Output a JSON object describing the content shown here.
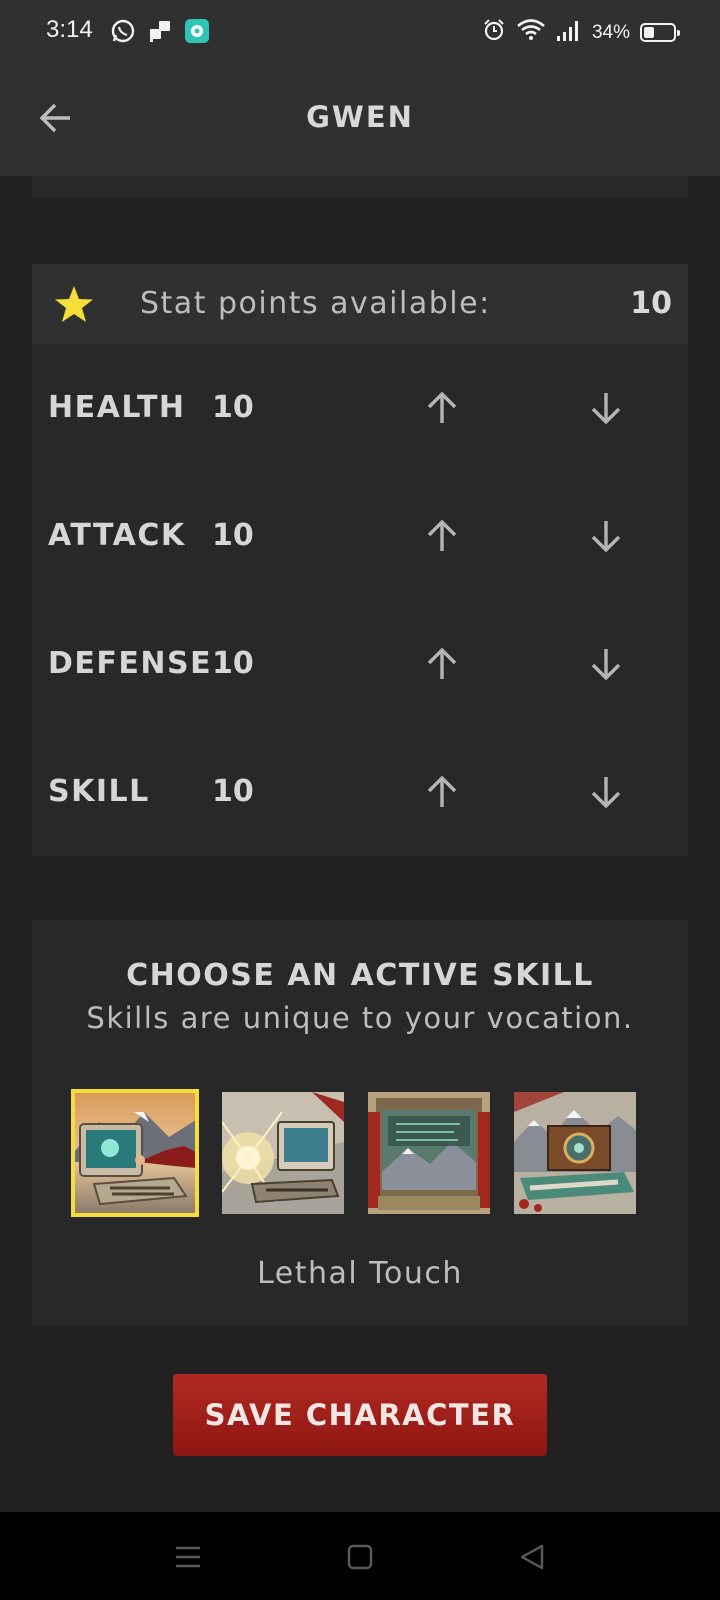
{
  "status_bar": {
    "time": "3:14",
    "battery_text": "34%",
    "battery_level": 0.34,
    "left_icons": [
      "whatsapp-icon",
      "message-icon",
      "app-icon"
    ],
    "right_icons": [
      "alarm-icon",
      "wifi-icon",
      "signal-icon",
      "battery-icon"
    ]
  },
  "app_bar": {
    "title": "GWEN",
    "back_icon": "arrow-left-icon"
  },
  "stats": {
    "points_label": "Stat points available:",
    "points_value": "10",
    "star_color": "#f5de3a",
    "rows": [
      {
        "name": "HEALTH",
        "value": "10"
      },
      {
        "name": "ATTACK",
        "value": "10"
      },
      {
        "name": "DEFENSE",
        "value": "10"
      },
      {
        "name": "SKILL",
        "value": "10"
      }
    ]
  },
  "skills": {
    "title": "CHOOSE AN ACTIVE SKILL",
    "subtitle": "Skills are unique to your vocation.",
    "selected_name": "Lethal Touch",
    "selected_index": 0,
    "highlight_color": "#f5de3a"
  },
  "actions": {
    "save_label": "SAVE CHARACTER",
    "save_color": "#a11d18"
  },
  "nav_bar": {
    "icons": [
      "menu-icon",
      "home-square-icon",
      "back-triangle-icon"
    ]
  }
}
